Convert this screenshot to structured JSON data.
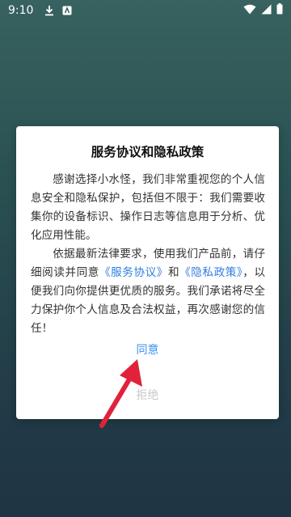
{
  "status_bar": {
    "time": "9:10",
    "icons": [
      "download-icon",
      "notification-icon",
      "wifi-icon",
      "signal-icon",
      "battery-icon"
    ]
  },
  "dialog": {
    "title": "服务协议和隐私政策",
    "para1": "感谢选择小水怪，我们非常重视您的个人信息安全和隐私保护，包括但不限于：我们需要收集你的设备标识、操作日志等信息用于分析、优化应用性能。",
    "para2_prefix": "依据最新法律要求，使用我们产品前，请仔细阅读并同意",
    "service_link": "《服务协议》",
    "and_text": "和",
    "privacy_link": "《隐私政策》",
    "para2_suffix": "，以便我们向你提供更优质的服务。我们承诺将尽全力保护你个人信息及合法权益，再次感谢您的信任！",
    "agree_label": "同意",
    "refuse_label": "拒绝"
  },
  "colors": {
    "accent": "#3d93f0",
    "link": "#2f7fe0",
    "disabled": "#c8c8c8",
    "arrow": "#e0223a"
  }
}
